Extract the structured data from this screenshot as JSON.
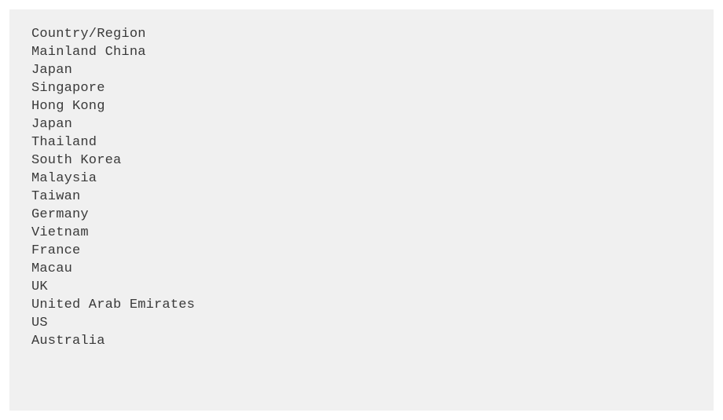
{
  "output": {
    "header": "Country/Region",
    "rows": [
      "Mainland China",
      "Japan",
      "Singapore",
      "Hong Kong",
      "Japan",
      "Thailand",
      "South Korea",
      "Malaysia",
      "Taiwan",
      "Germany",
      "Vietnam",
      "France",
      "Macau",
      "UK",
      "United Arab Emirates",
      "US",
      "Australia"
    ]
  }
}
